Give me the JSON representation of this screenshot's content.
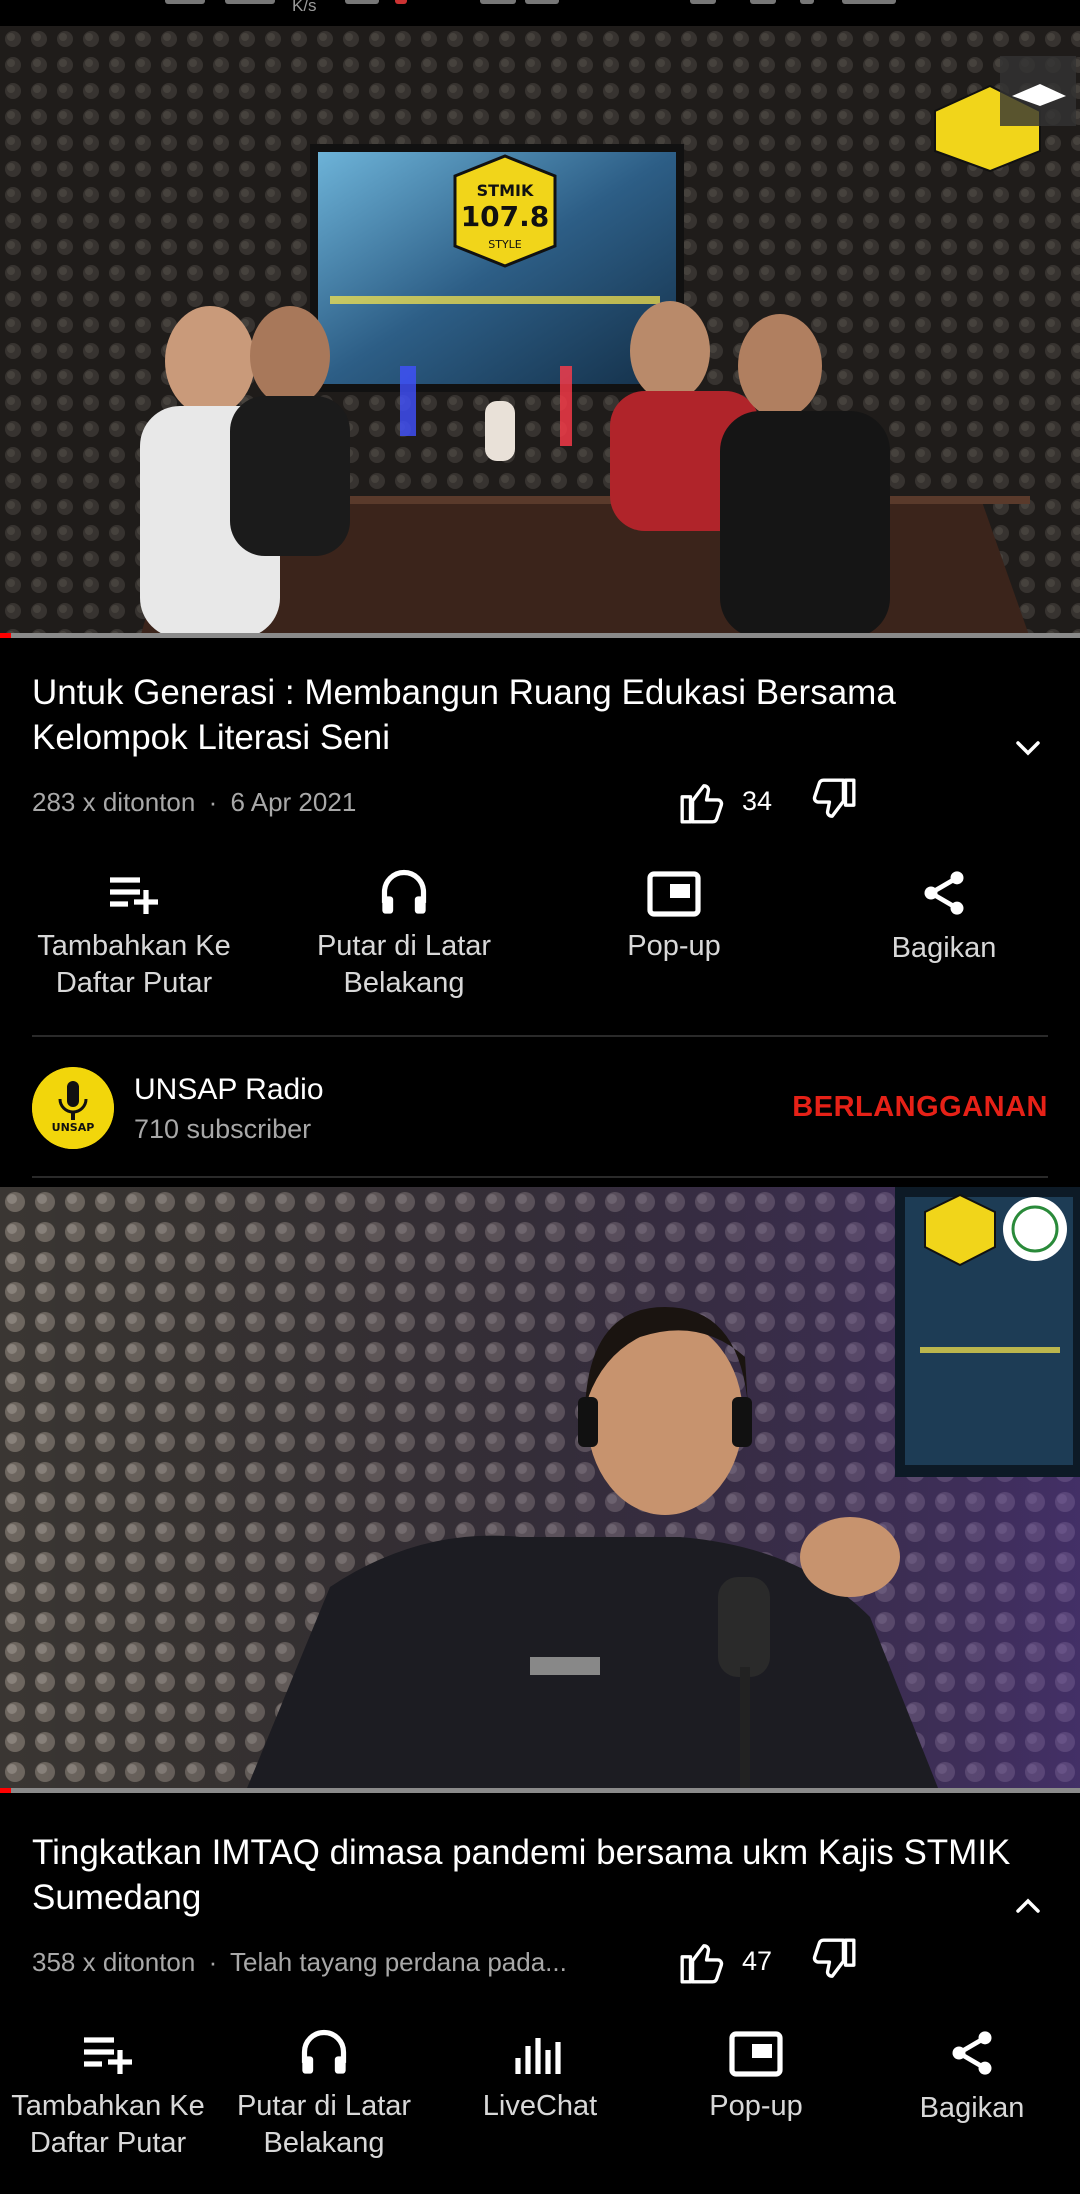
{
  "status_bar": {
    "speed_unit": "K/s"
  },
  "video1": {
    "title": "Untuk Generasi : Membangun Ruang Edukasi Bersama Kelompok Literasi Seni",
    "views": "283 x ditonton",
    "date": "6 Apr 2021",
    "separator": "·",
    "likes": "34",
    "progress_fraction": 0.01,
    "thumbnail_logo_text": [
      "STMIK",
      "107.8",
      "STYLE"
    ]
  },
  "actions1": [
    {
      "name": "add-to-playlist",
      "icon": "playlist-add-icon",
      "label": "Tambahkan Ke Daftar Putar"
    },
    {
      "name": "background-play",
      "icon": "headphones-icon",
      "label": "Putar di Latar Belakang"
    },
    {
      "name": "popup",
      "icon": "popup-icon",
      "label": "Pop-up"
    },
    {
      "name": "share",
      "icon": "share-icon",
      "label": "Bagikan"
    }
  ],
  "channel": {
    "name": "UNSAP Radio",
    "subscribers": "710 subscriber",
    "subscribe_label": "BERLANGGANAN",
    "avatar_text": "UNSAP"
  },
  "video2": {
    "title": "Tingkatkan IMTAQ dimasa pandemi bersama ukm Kajis STMIK Sumedang",
    "views": "358 x ditonton",
    "date": "Telah tayang perdana pada...",
    "separator": "·",
    "likes": "47",
    "progress_fraction": 0.01
  },
  "actions2": [
    {
      "name": "add-to-playlist",
      "icon": "playlist-add-icon",
      "label": "Tambahkan Ke Daftar Putar"
    },
    {
      "name": "background-play",
      "icon": "headphones-icon",
      "label": "Putar di Latar Belakang"
    },
    {
      "name": "livechat",
      "icon": "livechat-bars-icon",
      "label": "LiveChat"
    },
    {
      "name": "popup",
      "icon": "popup-icon",
      "label": "Pop-up"
    },
    {
      "name": "share",
      "icon": "share-icon",
      "label": "Bagikan"
    }
  ],
  "colors": {
    "subscribe": "#e62117",
    "progress": "#ff0000",
    "avatar": "#f2d60b"
  }
}
